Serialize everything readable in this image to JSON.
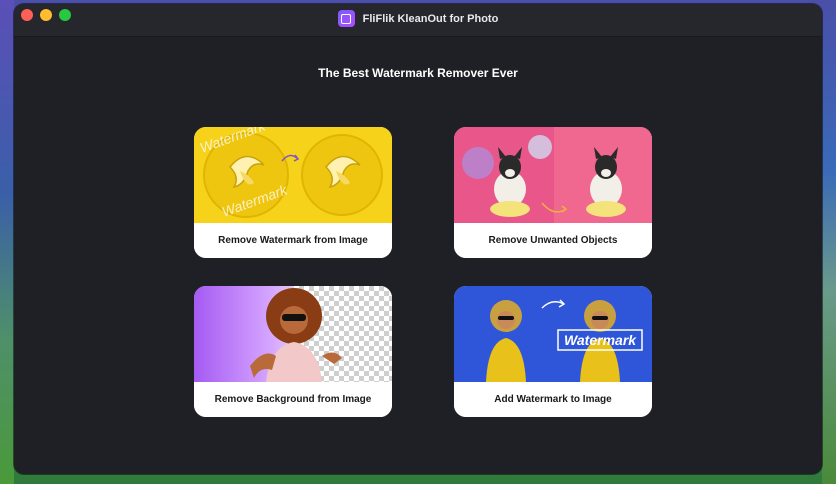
{
  "window": {
    "title": "FliFlik KleanOut for Photo"
  },
  "main": {
    "headline": "The Best Watermark Remover Ever",
    "cards": [
      {
        "label": "Remove Watermark from Image"
      },
      {
        "label": "Remove Unwanted Objects"
      },
      {
        "label": "Remove Background from Image"
      },
      {
        "label": "Add Watermark to Image"
      }
    ]
  },
  "thumbs": {
    "watermark_text": "Watermark"
  },
  "colors": {
    "window_bg": "#1f2026",
    "titlebar": "#26272d",
    "card_bg": "#ffffff",
    "yellow_thumb": "#f7d21a",
    "pink_thumb": "#e8568a",
    "purple_thumb": "#a55bf3",
    "blue_thumb": "#2f56d8"
  }
}
